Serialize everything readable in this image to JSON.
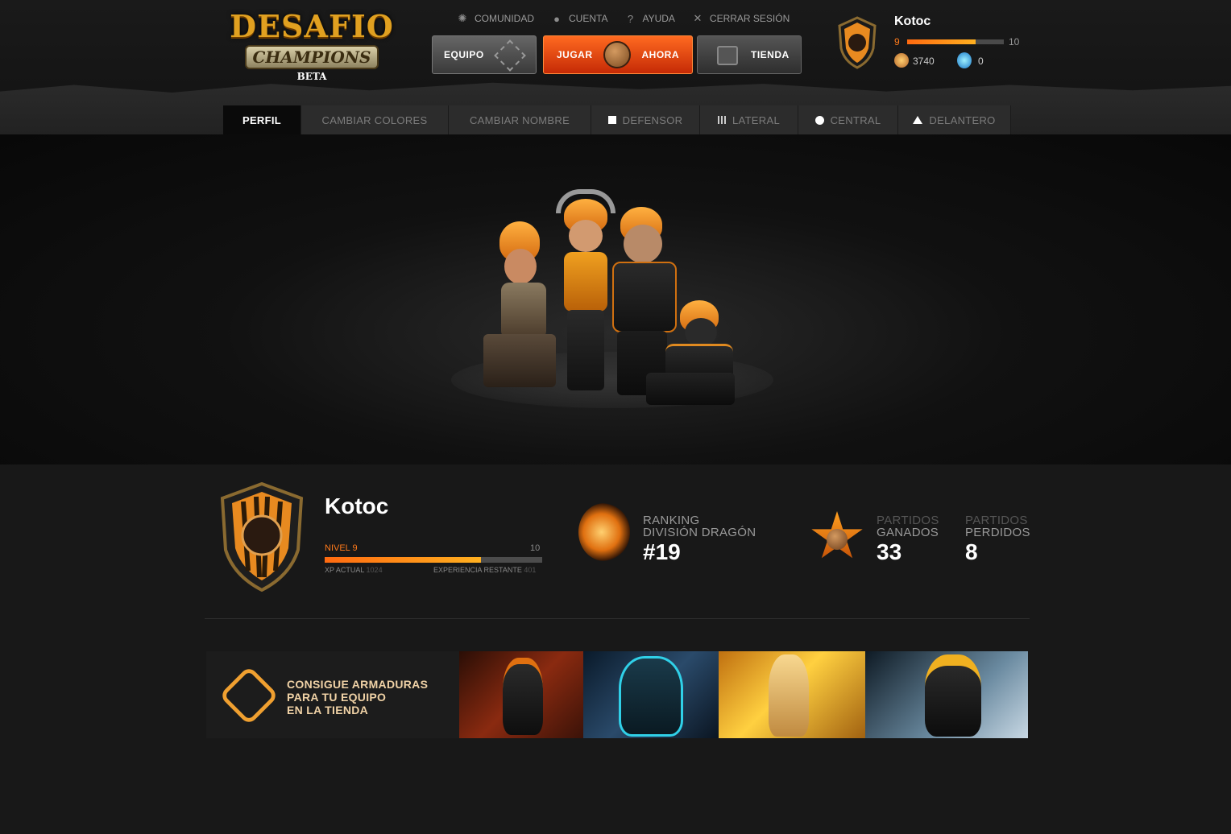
{
  "logo": {
    "title": "DESAFIO",
    "subtitle": "CHAMPIONS",
    "badge": "BETA"
  },
  "top_nav": [
    {
      "label": "COMUNIDAD",
      "icon": "community-icon"
    },
    {
      "label": "CUENTA",
      "icon": "account-icon"
    },
    {
      "label": "AYUDA",
      "icon": "help-icon"
    },
    {
      "label": "CERRAR SESIÓN",
      "icon": "logout-icon"
    }
  ],
  "main_buttons": {
    "equipo": "EQUIPO",
    "jugar": "JUGAR",
    "ahora": "AHORA",
    "tienda": "TIENDA"
  },
  "header_user": {
    "username": "Kotoc",
    "level": "9",
    "max_level": "10",
    "xp_fraction": 0.71,
    "coins": "3740",
    "gems": "0"
  },
  "tabs": [
    {
      "label": "PERFIL",
      "active": true,
      "icon": ""
    },
    {
      "label": "CAMBIAR COLORES",
      "active": false,
      "icon": ""
    },
    {
      "label": "CAMBIAR NOMBRE",
      "active": false,
      "icon": ""
    },
    {
      "label": "DEFENSOR",
      "active": false,
      "icon": "square-icon"
    },
    {
      "label": "LATERAL",
      "active": false,
      "icon": "lines-icon"
    },
    {
      "label": "CENTRAL",
      "active": false,
      "icon": "circle-icon"
    },
    {
      "label": "DELANTERO",
      "active": false,
      "icon": "triangle-icon"
    }
  ],
  "profile": {
    "name": "Kotoc",
    "level_label": "NIVEL 9",
    "max_level": "10",
    "xp_fraction": 0.72,
    "xp_current_label": "XP ACTUAL",
    "xp_current_value": "1024",
    "xp_remaining_label": "EXPERIENCIA RESTANTE",
    "xp_remaining_value": "401",
    "ranking_line1": "RANKING",
    "ranking_line2": "DIVISIÓN DRAGÓN",
    "ranking_value": "#19",
    "won_line1": "PARTIDOS",
    "won_line2": "GANADOS",
    "won_value": "33",
    "lost_line1": "PARTIDOS",
    "lost_line2": "PERDIDOS",
    "lost_value": "8"
  },
  "promo": {
    "line1": "CONSIGUE ARMADURAS",
    "line2": "PARA TU EQUIPO",
    "line3": "EN LA TIENDA"
  },
  "colors": {
    "accent": "#ff6a10",
    "bar": "#ffb020",
    "background": "#181818"
  }
}
